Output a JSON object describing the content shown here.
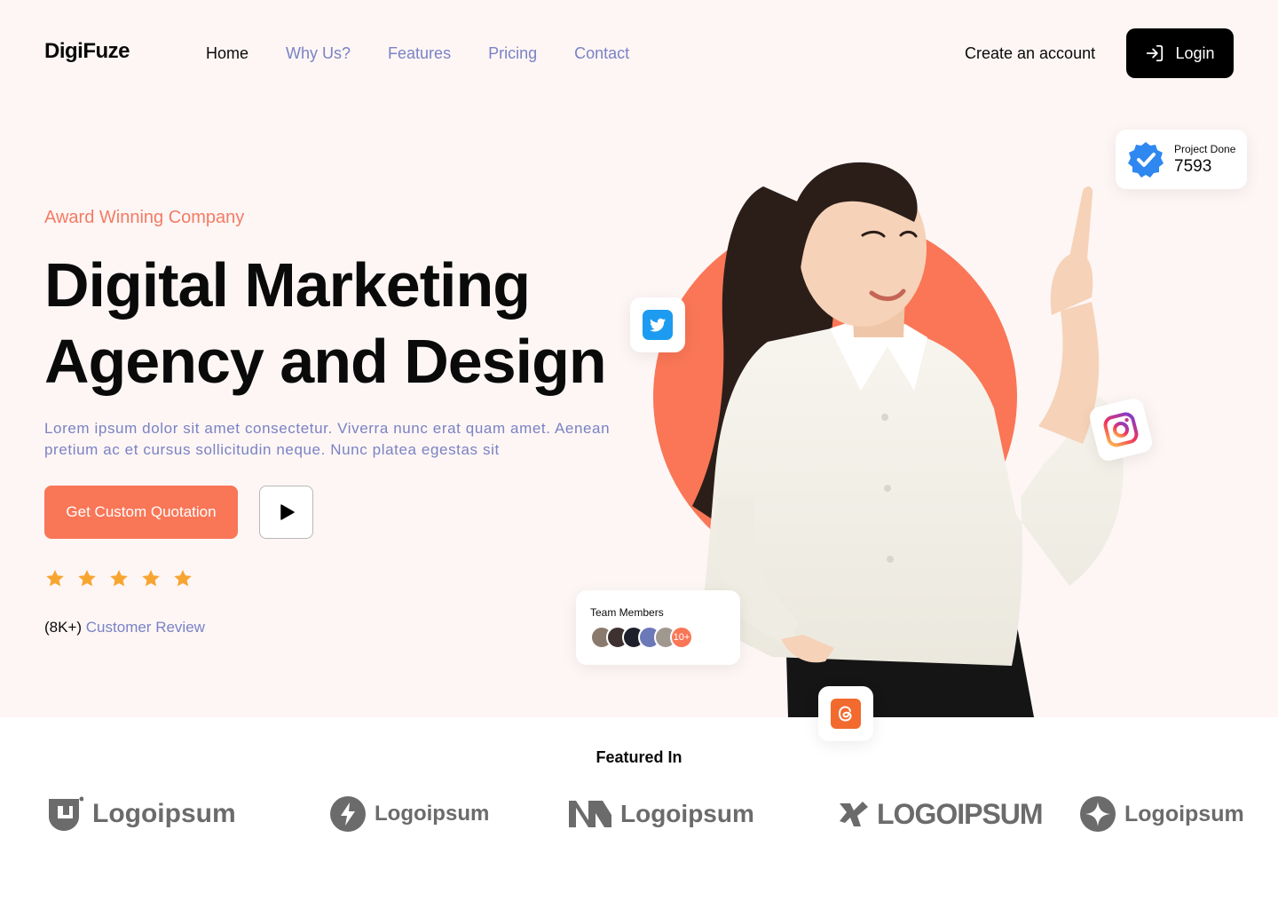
{
  "header": {
    "brand": "DigiFuze",
    "nav": [
      {
        "label": "Home",
        "active": true
      },
      {
        "label": "Why Us?",
        "active": false
      },
      {
        "label": "Features",
        "active": false
      },
      {
        "label": "Pricing",
        "active": false
      },
      {
        "label": "Contact",
        "active": false
      }
    ],
    "create_account": "Create an account",
    "login": "Login",
    "login_icon": "login-arrow-icon"
  },
  "hero": {
    "eyebrow": "Award Winning Company",
    "headline_line1": "Digital Marketing",
    "headline_line2": "Agency and Design",
    "lead": "Lorem ipsum dolor sit amet consectetur. Viverra nunc erat quam amet. Aenean pretium ac et cursus sollicitudin neque. Nunc platea egestas sit",
    "cta": "Get Custom Quotation",
    "play_icon": "play-icon",
    "rating": 5,
    "review_count": "(8K+)",
    "review_label": "Customer Review"
  },
  "cards": {
    "project_label": "Project Done",
    "project_value": "7593",
    "team_label": "Team Members",
    "team_more": "10+"
  },
  "social_icons": [
    "twitter-icon",
    "instagram-icon",
    "threads-icon"
  ],
  "featured": {
    "title": "Featured In",
    "logos": [
      "Logoipsum",
      "Logoipsum",
      "Logoipsum",
      "LOGOIPSUM",
      "Logoipsum"
    ]
  },
  "colors": {
    "accent": "#f97657",
    "link": "#7a82c4",
    "hero_bg": "#fdf6f5",
    "star": "#f7a531",
    "verified": "#2f88f0"
  }
}
